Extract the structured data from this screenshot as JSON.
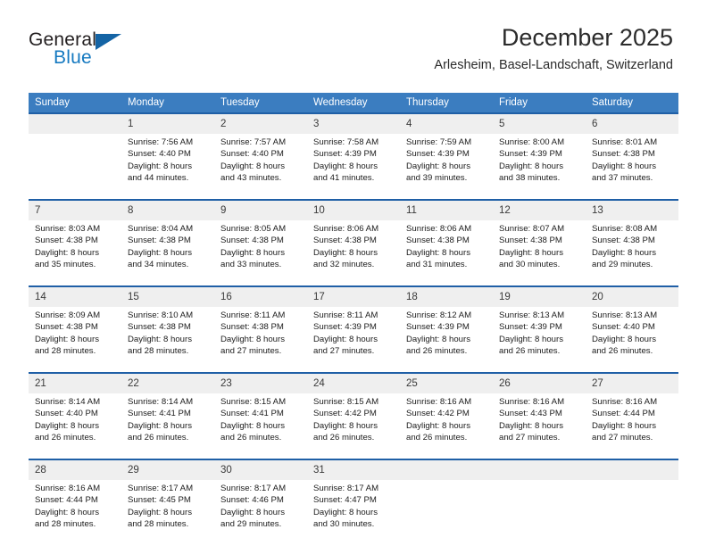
{
  "brand": {
    "name_top": "General",
    "name_bottom": "Blue",
    "triangle_icon": "triangle-icon",
    "colors": {
      "dark": "#231f20",
      "blue": "#1579c0",
      "triangle": "#1464a5"
    }
  },
  "header": {
    "title": "December 2025",
    "subtitle": "Arlesheim, Basel-Landschaft, Switzerland"
  },
  "calendar": {
    "header_bg": "#3b7dc0",
    "separator_color": "#1f5fa6",
    "daynum_bg": "#efefef",
    "weekdays": [
      "Sunday",
      "Monday",
      "Tuesday",
      "Wednesday",
      "Thursday",
      "Friday",
      "Saturday"
    ],
    "weeks": [
      [
        {
          "day": "",
          "lines": []
        },
        {
          "day": "1",
          "lines": [
            "Sunrise: 7:56 AM",
            "Sunset: 4:40 PM",
            "Daylight: 8 hours",
            "and 44 minutes."
          ]
        },
        {
          "day": "2",
          "lines": [
            "Sunrise: 7:57 AM",
            "Sunset: 4:40 PM",
            "Daylight: 8 hours",
            "and 43 minutes."
          ]
        },
        {
          "day": "3",
          "lines": [
            "Sunrise: 7:58 AM",
            "Sunset: 4:39 PM",
            "Daylight: 8 hours",
            "and 41 minutes."
          ]
        },
        {
          "day": "4",
          "lines": [
            "Sunrise: 7:59 AM",
            "Sunset: 4:39 PM",
            "Daylight: 8 hours",
            "and 39 minutes."
          ]
        },
        {
          "day": "5",
          "lines": [
            "Sunrise: 8:00 AM",
            "Sunset: 4:39 PM",
            "Daylight: 8 hours",
            "and 38 minutes."
          ]
        },
        {
          "day": "6",
          "lines": [
            "Sunrise: 8:01 AM",
            "Sunset: 4:38 PM",
            "Daylight: 8 hours",
            "and 37 minutes."
          ]
        }
      ],
      [
        {
          "day": "7",
          "lines": [
            "Sunrise: 8:03 AM",
            "Sunset: 4:38 PM",
            "Daylight: 8 hours",
            "and 35 minutes."
          ]
        },
        {
          "day": "8",
          "lines": [
            "Sunrise: 8:04 AM",
            "Sunset: 4:38 PM",
            "Daylight: 8 hours",
            "and 34 minutes."
          ]
        },
        {
          "day": "9",
          "lines": [
            "Sunrise: 8:05 AM",
            "Sunset: 4:38 PM",
            "Daylight: 8 hours",
            "and 33 minutes."
          ]
        },
        {
          "day": "10",
          "lines": [
            "Sunrise: 8:06 AM",
            "Sunset: 4:38 PM",
            "Daylight: 8 hours",
            "and 32 minutes."
          ]
        },
        {
          "day": "11",
          "lines": [
            "Sunrise: 8:06 AM",
            "Sunset: 4:38 PM",
            "Daylight: 8 hours",
            "and 31 minutes."
          ]
        },
        {
          "day": "12",
          "lines": [
            "Sunrise: 8:07 AM",
            "Sunset: 4:38 PM",
            "Daylight: 8 hours",
            "and 30 minutes."
          ]
        },
        {
          "day": "13",
          "lines": [
            "Sunrise: 8:08 AM",
            "Sunset: 4:38 PM",
            "Daylight: 8 hours",
            "and 29 minutes."
          ]
        }
      ],
      [
        {
          "day": "14",
          "lines": [
            "Sunrise: 8:09 AM",
            "Sunset: 4:38 PM",
            "Daylight: 8 hours",
            "and 28 minutes."
          ]
        },
        {
          "day": "15",
          "lines": [
            "Sunrise: 8:10 AM",
            "Sunset: 4:38 PM",
            "Daylight: 8 hours",
            "and 28 minutes."
          ]
        },
        {
          "day": "16",
          "lines": [
            "Sunrise: 8:11 AM",
            "Sunset: 4:38 PM",
            "Daylight: 8 hours",
            "and 27 minutes."
          ]
        },
        {
          "day": "17",
          "lines": [
            "Sunrise: 8:11 AM",
            "Sunset: 4:39 PM",
            "Daylight: 8 hours",
            "and 27 minutes."
          ]
        },
        {
          "day": "18",
          "lines": [
            "Sunrise: 8:12 AM",
            "Sunset: 4:39 PM",
            "Daylight: 8 hours",
            "and 26 minutes."
          ]
        },
        {
          "day": "19",
          "lines": [
            "Sunrise: 8:13 AM",
            "Sunset: 4:39 PM",
            "Daylight: 8 hours",
            "and 26 minutes."
          ]
        },
        {
          "day": "20",
          "lines": [
            "Sunrise: 8:13 AM",
            "Sunset: 4:40 PM",
            "Daylight: 8 hours",
            "and 26 minutes."
          ]
        }
      ],
      [
        {
          "day": "21",
          "lines": [
            "Sunrise: 8:14 AM",
            "Sunset: 4:40 PM",
            "Daylight: 8 hours",
            "and 26 minutes."
          ]
        },
        {
          "day": "22",
          "lines": [
            "Sunrise: 8:14 AM",
            "Sunset: 4:41 PM",
            "Daylight: 8 hours",
            "and 26 minutes."
          ]
        },
        {
          "day": "23",
          "lines": [
            "Sunrise: 8:15 AM",
            "Sunset: 4:41 PM",
            "Daylight: 8 hours",
            "and 26 minutes."
          ]
        },
        {
          "day": "24",
          "lines": [
            "Sunrise: 8:15 AM",
            "Sunset: 4:42 PM",
            "Daylight: 8 hours",
            "and 26 minutes."
          ]
        },
        {
          "day": "25",
          "lines": [
            "Sunrise: 8:16 AM",
            "Sunset: 4:42 PM",
            "Daylight: 8 hours",
            "and 26 minutes."
          ]
        },
        {
          "day": "26",
          "lines": [
            "Sunrise: 8:16 AM",
            "Sunset: 4:43 PM",
            "Daylight: 8 hours",
            "and 27 minutes."
          ]
        },
        {
          "day": "27",
          "lines": [
            "Sunrise: 8:16 AM",
            "Sunset: 4:44 PM",
            "Daylight: 8 hours",
            "and 27 minutes."
          ]
        }
      ],
      [
        {
          "day": "28",
          "lines": [
            "Sunrise: 8:16 AM",
            "Sunset: 4:44 PM",
            "Daylight: 8 hours",
            "and 28 minutes."
          ]
        },
        {
          "day": "29",
          "lines": [
            "Sunrise: 8:17 AM",
            "Sunset: 4:45 PM",
            "Daylight: 8 hours",
            "and 28 minutes."
          ]
        },
        {
          "day": "30",
          "lines": [
            "Sunrise: 8:17 AM",
            "Sunset: 4:46 PM",
            "Daylight: 8 hours",
            "and 29 minutes."
          ]
        },
        {
          "day": "31",
          "lines": [
            "Sunrise: 8:17 AM",
            "Sunset: 4:47 PM",
            "Daylight: 8 hours",
            "and 30 minutes."
          ]
        },
        {
          "day": "",
          "lines": []
        },
        {
          "day": "",
          "lines": []
        },
        {
          "day": "",
          "lines": []
        }
      ]
    ]
  }
}
